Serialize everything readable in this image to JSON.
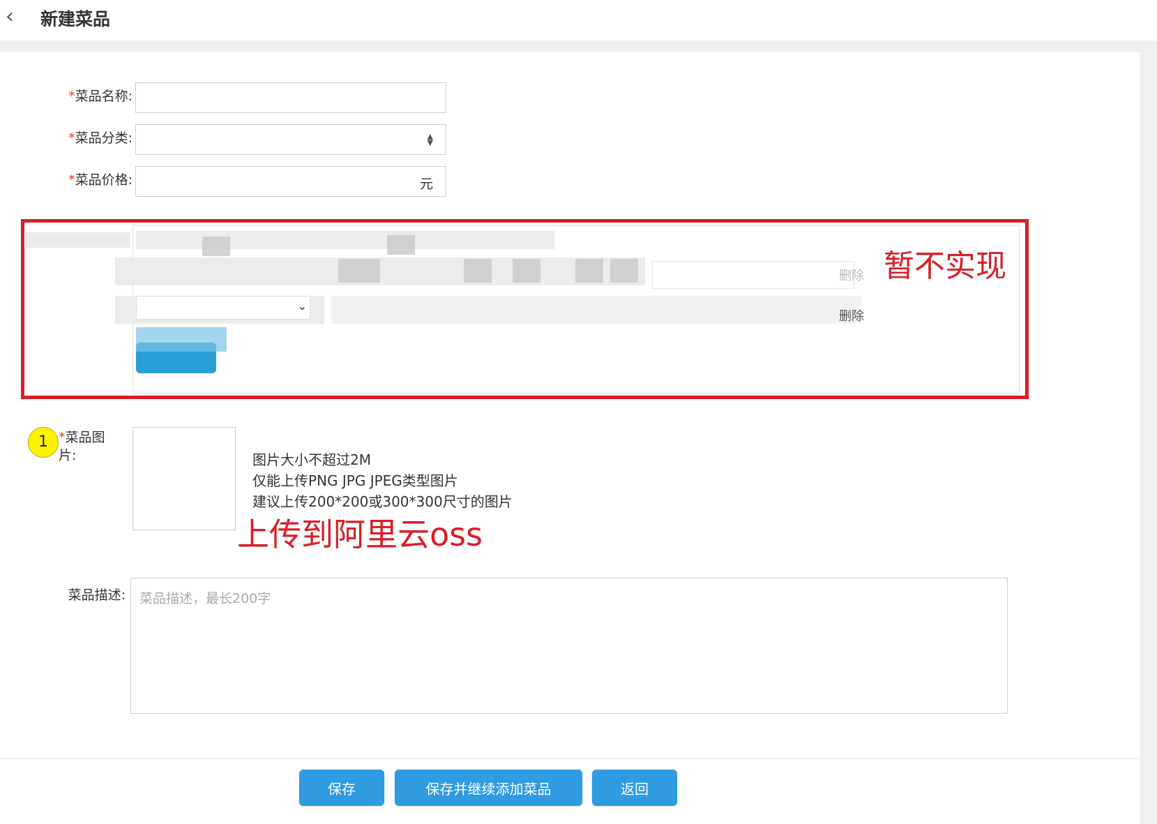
{
  "header": {
    "title": "新建菜品",
    "back_icon": "chevron-left-icon"
  },
  "form": {
    "name": {
      "label": "菜品名称:",
      "required_mark": "*",
      "value": ""
    },
    "category": {
      "label": "菜品分类:",
      "required_mark": "*",
      "value": ""
    },
    "price": {
      "label": "菜品价格:",
      "required_mark": "*",
      "value": "",
      "suffix": "元"
    },
    "flavor": {
      "delete_label_1": "删除",
      "delete_label_2": "删除"
    },
    "image": {
      "label_line1": "菜品图",
      "label_line2": "片:",
      "required_mark": "*",
      "tips": [
        "图片大小不超过2M",
        "仅能上传PNG JPG JPEG类型图片",
        "建议上传200*200或300*300尺寸的图片"
      ]
    },
    "description": {
      "label": "菜品描述:",
      "placeholder": "菜品描述，最长200字",
      "value": ""
    }
  },
  "annotations": {
    "not_implemented": "暂不实现",
    "upload_oss": "上传到阿里云oss",
    "step_number": "1"
  },
  "buttons": {
    "save": "保存",
    "save_continue": "保存并继续添加菜品",
    "back": "返回"
  },
  "colors": {
    "primary_button": "#2f9be0",
    "annotation_red": "#d81e28",
    "required_red": "#e53935",
    "marker_yellow": "#fff200"
  }
}
